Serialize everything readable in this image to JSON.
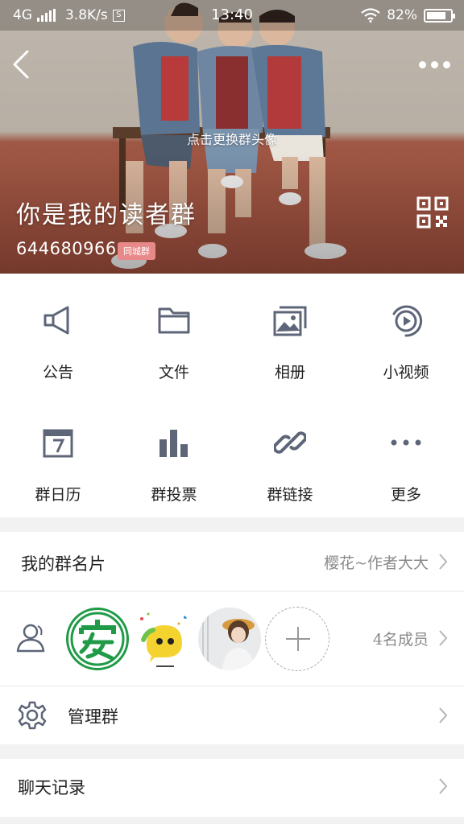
{
  "status_bar": {
    "network": "4G",
    "speed": "3.8K/s",
    "app_badge": "S",
    "time": "13:40",
    "battery": "82%",
    "battery_level": 0.82
  },
  "header": {
    "change_avatar_hint": "点击更换群头像",
    "group_name": "你是我的读者群",
    "group_id": "644680966",
    "city_tag": "同城群"
  },
  "grid": [
    {
      "label": "公告",
      "icon": "announcement-icon"
    },
    {
      "label": "文件",
      "icon": "folder-icon"
    },
    {
      "label": "相册",
      "icon": "album-icon"
    },
    {
      "label": "小视频",
      "icon": "video-icon"
    },
    {
      "label": "群日历",
      "icon": "calendar-icon"
    },
    {
      "label": "群投票",
      "icon": "poll-icon"
    },
    {
      "label": "群链接",
      "icon": "link-icon"
    },
    {
      "label": "更多",
      "icon": "more-icon"
    }
  ],
  "my_card": {
    "label": "我的群名片",
    "value": "樱花~作者大大"
  },
  "members": {
    "count_label": "4名成员"
  },
  "manage": {
    "label": "管理群"
  },
  "chat_history": {
    "label": "聊天记录"
  },
  "colors": {
    "icon_gray": "#5d6578",
    "link_blue": "#3a6fa0",
    "tag_red": "#e88888",
    "wall_beige": "#bcb4a9",
    "floor_red": "#a14f3d"
  }
}
